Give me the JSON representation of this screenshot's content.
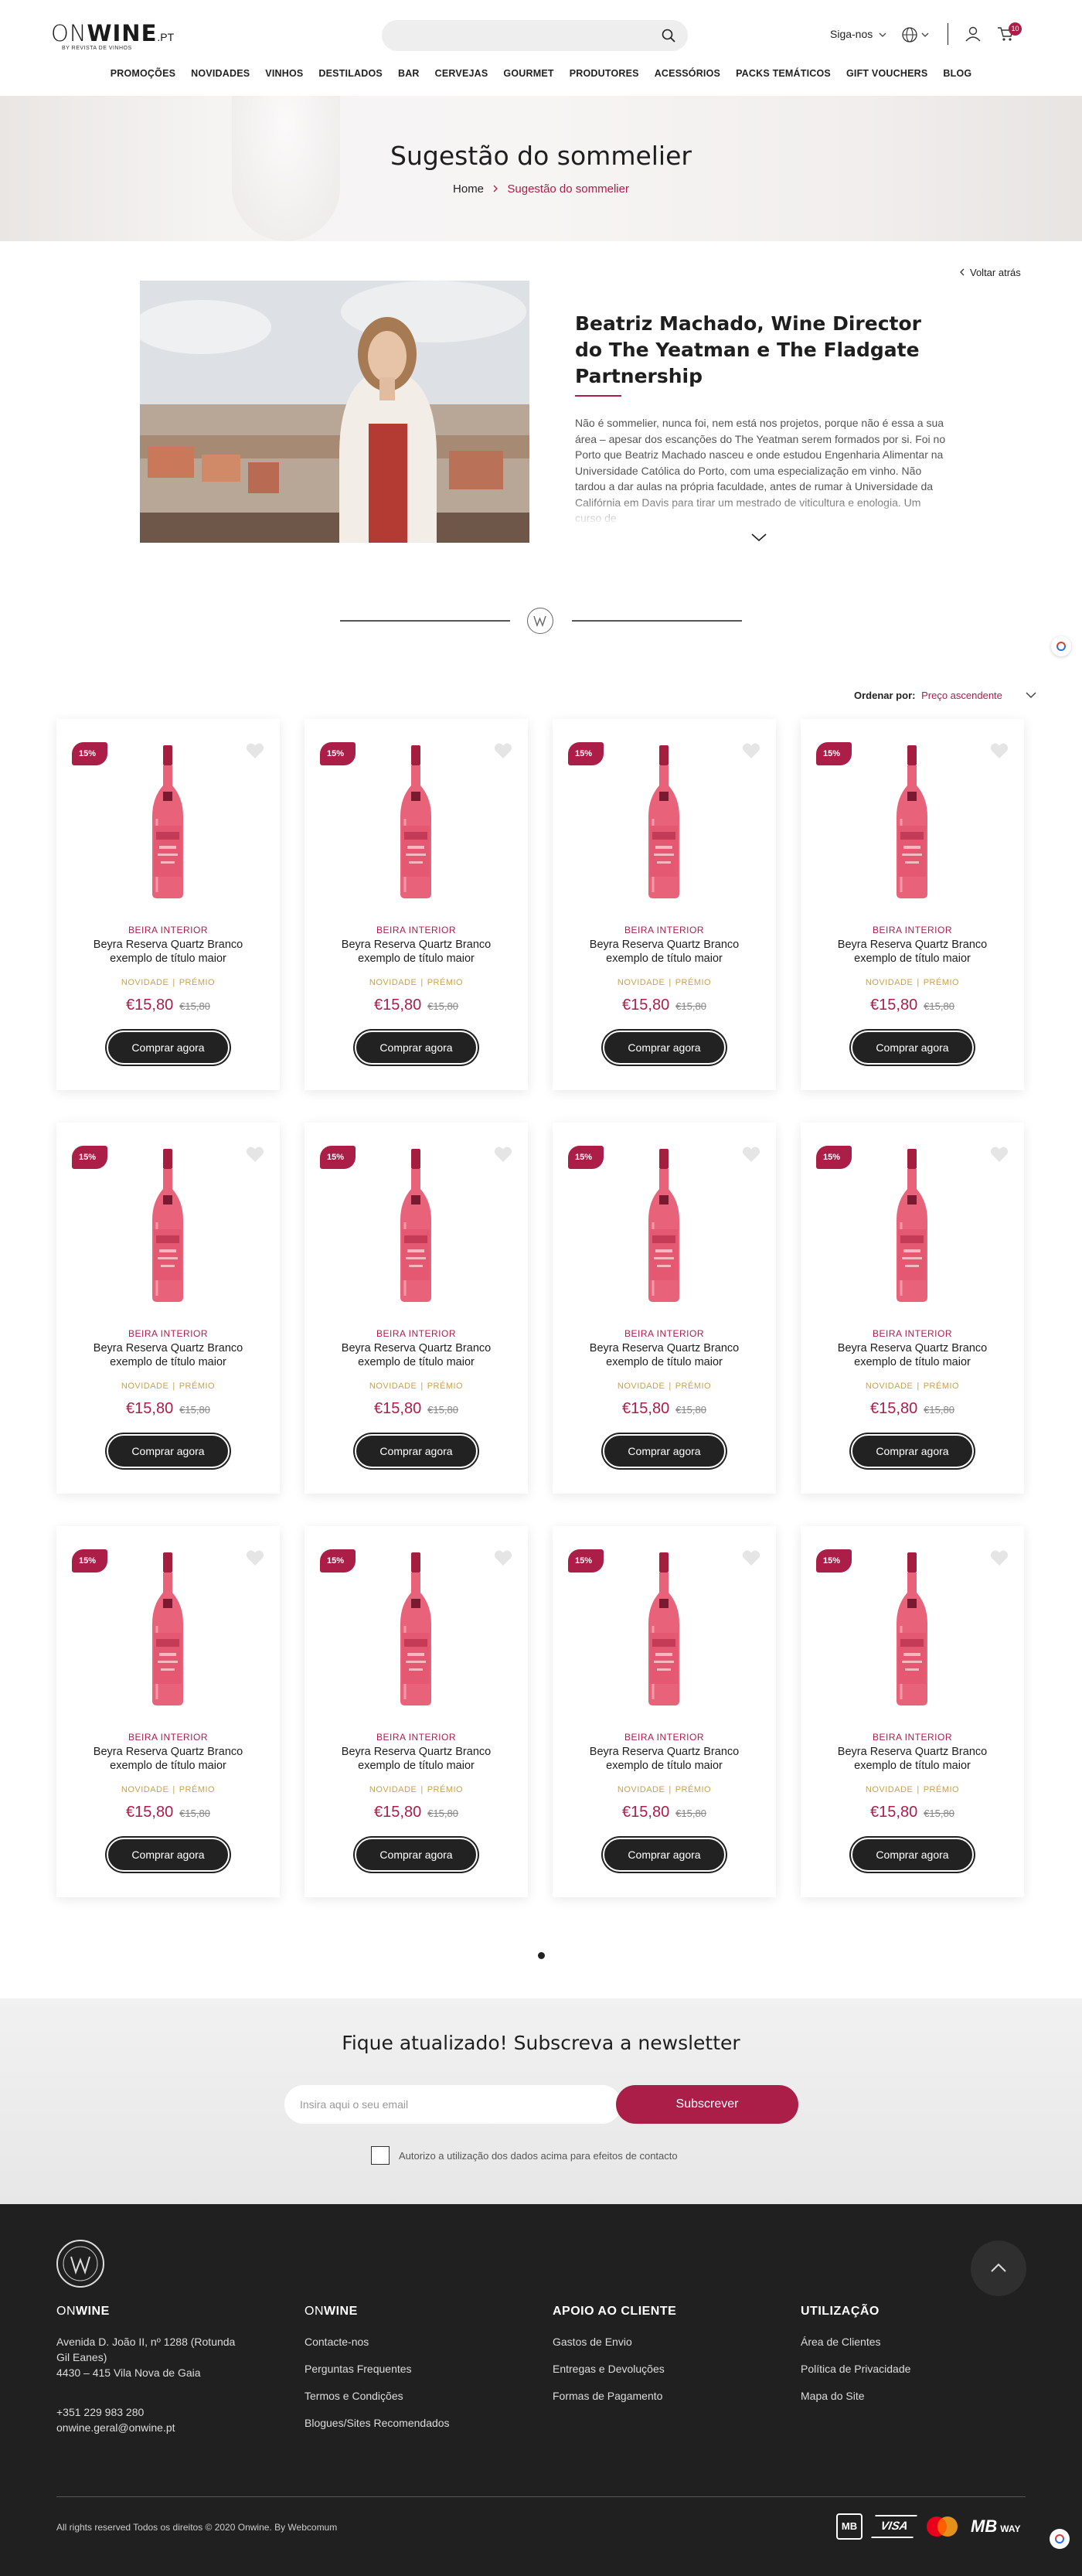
{
  "header": {
    "logo_on": "ON",
    "logo_wine": "WINE",
    "logo_tld": ".PT",
    "logo_by": "BY REVISTA DE VINHOS",
    "follow_label": "Siga-nos",
    "cart_count": "10",
    "nav": [
      "PROMOÇÕES",
      "NOVIDADES",
      "VINHOS",
      "DESTILADOS",
      "BAR",
      "CERVEJAS",
      "GOURMET",
      "PRODUTORES",
      "ACESSÓRIOS",
      "PACKS TEMÁTICOS",
      "GIFT VOUCHERS",
      "BLOG"
    ]
  },
  "hero": {
    "title": "Sugestão do sommelier",
    "breadcrumb_home": "Home",
    "breadcrumb_current": "Sugestão do sommelier"
  },
  "intro": {
    "back_label": "Voltar atrás",
    "title": "Beatriz Machado, Wine Director do The Yeatman e The Fladgate Partnership",
    "text": "Não é sommelier, nunca foi, nem está nos projetos, porque não é essa a sua área – apesar dos escanções do The Yeatman serem formados por si. Foi no Porto que Beatriz Machado nasceu e onde estudou Engenharia Alimentar na Universidade Católica do Porto, com uma especialização em vinho. Não tardou a dar aulas na própria faculdade, antes de rumar à Universidade da Califórnia em Davis para tirar um mestrado de viticultura e enologia. Um curso de"
  },
  "sort": {
    "label": "Ordenar por:",
    "value": "Preço ascendente"
  },
  "products": [
    {
      "discount": "15%",
      "region": "BEIRA INTERIOR",
      "name": "Beyra Reserva Quartz Branco exemplo de título maior",
      "tag1": "NOVIDADE",
      "tag2": "PRÉMIO",
      "price": "€15,80",
      "old_price": "€15,80",
      "button": "Comprar agora"
    },
    {
      "discount": "15%",
      "region": "BEIRA INTERIOR",
      "name": "Beyra Reserva Quartz Branco exemplo de título maior",
      "tag1": "NOVIDADE",
      "tag2": "PRÉMIO",
      "price": "€15,80",
      "old_price": "€15,80",
      "button": "Comprar agora"
    },
    {
      "discount": "15%",
      "region": "BEIRA INTERIOR",
      "name": "Beyra Reserva Quartz Branco exemplo de título maior",
      "tag1": "NOVIDADE",
      "tag2": "PRÉMIO",
      "price": "€15,80",
      "old_price": "€15,80",
      "button": "Comprar agora"
    },
    {
      "discount": "15%",
      "region": "BEIRA INTERIOR",
      "name": "Beyra Reserva Quartz Branco exemplo de título maior",
      "tag1": "NOVIDADE",
      "tag2": "PRÉMIO",
      "price": "€15,80",
      "old_price": "€15,80",
      "button": "Comprar agora"
    },
    {
      "discount": "15%",
      "region": "BEIRA INTERIOR",
      "name": "Beyra Reserva Quartz Branco exemplo de título maior",
      "tag1": "NOVIDADE",
      "tag2": "PRÉMIO",
      "price": "€15,80",
      "old_price": "€15,80",
      "button": "Comprar agora"
    },
    {
      "discount": "15%",
      "region": "BEIRA INTERIOR",
      "name": "Beyra Reserva Quartz Branco exemplo de título maior",
      "tag1": "NOVIDADE",
      "tag2": "PRÉMIO",
      "price": "€15,80",
      "old_price": "€15,80",
      "button": "Comprar agora"
    },
    {
      "discount": "15%",
      "region": "BEIRA INTERIOR",
      "name": "Beyra Reserva Quartz Branco exemplo de título maior",
      "tag1": "NOVIDADE",
      "tag2": "PRÉMIO",
      "price": "€15,80",
      "old_price": "€15,80",
      "button": "Comprar agora"
    },
    {
      "discount": "15%",
      "region": "BEIRA INTERIOR",
      "name": "Beyra Reserva Quartz Branco exemplo de título maior",
      "tag1": "NOVIDADE",
      "tag2": "PRÉMIO",
      "price": "€15,80",
      "old_price": "€15,80",
      "button": "Comprar agora"
    },
    {
      "discount": "15%",
      "region": "BEIRA INTERIOR",
      "name": "Beyra Reserva Quartz Branco exemplo de título maior",
      "tag1": "NOVIDADE",
      "tag2": "PRÉMIO",
      "price": "€15,80",
      "old_price": "€15,80",
      "button": "Comprar agora"
    },
    {
      "discount": "15%",
      "region": "BEIRA INTERIOR",
      "name": "Beyra Reserva Quartz Branco exemplo de título maior",
      "tag1": "NOVIDADE",
      "tag2": "PRÉMIO",
      "price": "€15,80",
      "old_price": "€15,80",
      "button": "Comprar agora"
    },
    {
      "discount": "15%",
      "region": "BEIRA INTERIOR",
      "name": "Beyra Reserva Quartz Branco exemplo de título maior",
      "tag1": "NOVIDADE",
      "tag2": "PRÉMIO",
      "price": "€15,80",
      "old_price": "€15,80",
      "button": "Comprar agora"
    },
    {
      "discount": "15%",
      "region": "BEIRA INTERIOR",
      "name": "Beyra Reserva Quartz Branco exemplo de título maior",
      "tag1": "NOVIDADE",
      "tag2": "PRÉMIO",
      "price": "€15,80",
      "old_price": "€15,80",
      "button": "Comprar agora"
    }
  ],
  "newsletter": {
    "title": "Fique atualizado! Subscreva a newsletter",
    "email_placeholder": "Insira aqui o seu email",
    "subscribe_label": "Subscrever",
    "consent_label": "Autorizo a utilização dos dados acima para efeitos de contacto"
  },
  "footer": {
    "col1": {
      "title_on": "ON",
      "title_wine": "WINE",
      "address1": "Avenida D. João II, nº 1288 (Rotunda Gil Eanes)",
      "address2": "4430 – 415 Vila Nova de Gaia",
      "phone": "+351 229 983 280",
      "email": "onwine.geral@onwine.pt"
    },
    "col2": {
      "title_on": "ON",
      "title_wine": "WINE",
      "links": [
        "Contacte-nos",
        "Perguntas Frequentes",
        "Termos e Condições",
        "Blogues/Sites Recomendados"
      ]
    },
    "col3": {
      "title": "APOIO AO CLIENTE",
      "links": [
        "Gastos de Envio",
        "Entregas e Devoluções",
        "Formas de Pagamento"
      ]
    },
    "col4": {
      "title": "UTILIZAÇÃO",
      "links": [
        "Área de Clientes",
        "Política de Privacidade",
        "Mapa do Site"
      ]
    },
    "copyright": "All rights reserved Todos os direitos © 2020 Onwine. By Webcomum",
    "payments": {
      "mb": "MB",
      "visa": "VISA",
      "mbway_mb": "MB",
      "mbway_way": "WAY"
    }
  },
  "colors": {
    "accent": "#ab1e48",
    "dark": "#202020",
    "gold": "#c9a24a"
  }
}
